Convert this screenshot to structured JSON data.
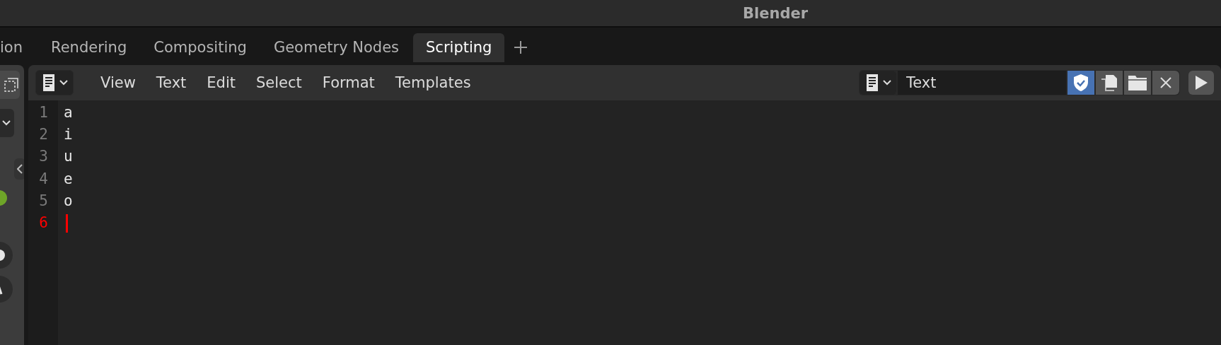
{
  "window": {
    "title": "Blender"
  },
  "tabs": [
    {
      "label": "ion",
      "selected": false
    },
    {
      "label": "Rendering",
      "selected": false
    },
    {
      "label": "Compositing",
      "selected": false
    },
    {
      "label": "Geometry Nodes",
      "selected": false
    },
    {
      "label": "Scripting",
      "selected": true
    }
  ],
  "text_editor": {
    "menus": [
      "View",
      "Text",
      "Edit",
      "Select",
      "Format",
      "Templates"
    ],
    "datablock_name": "Text",
    "register_on": true,
    "lines": [
      {
        "number": "1",
        "text": "a",
        "current": false
      },
      {
        "number": "2",
        "text": "i",
        "current": false
      },
      {
        "number": "3",
        "text": "u",
        "current": false
      },
      {
        "number": "4",
        "text": "e",
        "current": false
      },
      {
        "number": "5",
        "text": "o",
        "current": false
      },
      {
        "number": "6",
        "current": true
      }
    ]
  }
}
